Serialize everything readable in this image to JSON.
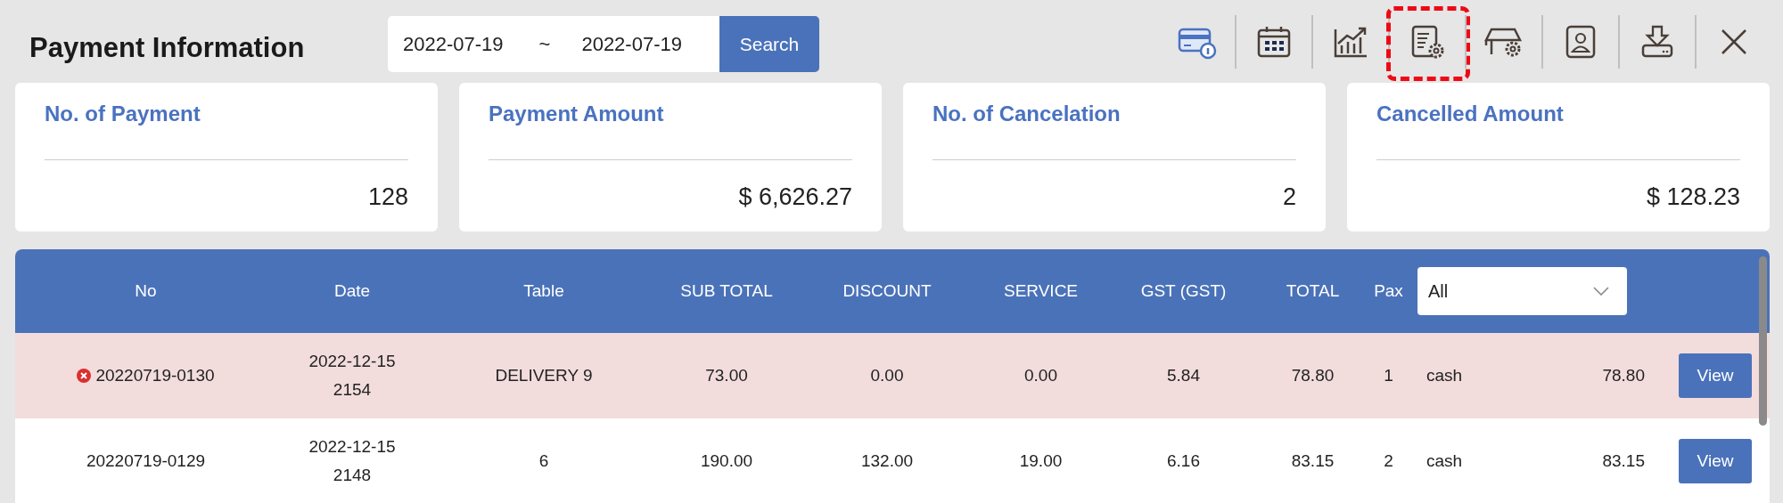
{
  "header": {
    "title": "Payment Information",
    "date_range": {
      "from": "2022-07-19",
      "separator": "~",
      "to": "2022-07-19"
    },
    "search_button": "Search"
  },
  "toolbar": [
    {
      "kind": "card",
      "highlighted": false
    },
    {
      "kind": "calendar",
      "highlighted": false
    },
    {
      "kind": "chart",
      "highlighted": false
    },
    {
      "kind": "document",
      "highlighted": true
    },
    {
      "kind": "store",
      "highlighted": false
    },
    {
      "kind": "contact",
      "highlighted": false
    },
    {
      "kind": "download",
      "highlighted": false
    },
    {
      "kind": "close",
      "highlighted": false
    }
  ],
  "summary_cards": [
    {
      "title": "No. of Payment",
      "value": "128"
    },
    {
      "title": "Payment Amount",
      "value": "$ 6,626.27"
    },
    {
      "title": "No. of Cancelation",
      "value": "2"
    },
    {
      "title": "Cancelled Amount",
      "value": "$ 128.23"
    }
  ],
  "table": {
    "columns": [
      "No",
      "Date",
      "Table",
      "SUB TOTAL",
      "DISCOUNT",
      "SERVICE",
      "GST (GST)",
      "TOTAL",
      "Pax"
    ],
    "filter": {
      "value": "All"
    },
    "rows": [
      {
        "cancelled": true,
        "no": "20220719-0130",
        "date": "2022-12-15",
        "time": "2154",
        "table": "DELIVERY 9",
        "sub_total": "73.00",
        "discount": "0.00",
        "service": "0.00",
        "gst": "5.84",
        "total": "78.80",
        "pax": "1",
        "method": "cash",
        "amount": "78.80",
        "action": "View"
      },
      {
        "cancelled": false,
        "no": "20220719-0129",
        "date": "2022-12-15",
        "time": "2148",
        "table": "6",
        "sub_total": "190.00",
        "discount": "132.00",
        "service": "19.00",
        "gst": "6.16",
        "total": "83.15",
        "pax": "2",
        "method": "cash",
        "amount": "83.15",
        "action": "View"
      }
    ]
  }
}
